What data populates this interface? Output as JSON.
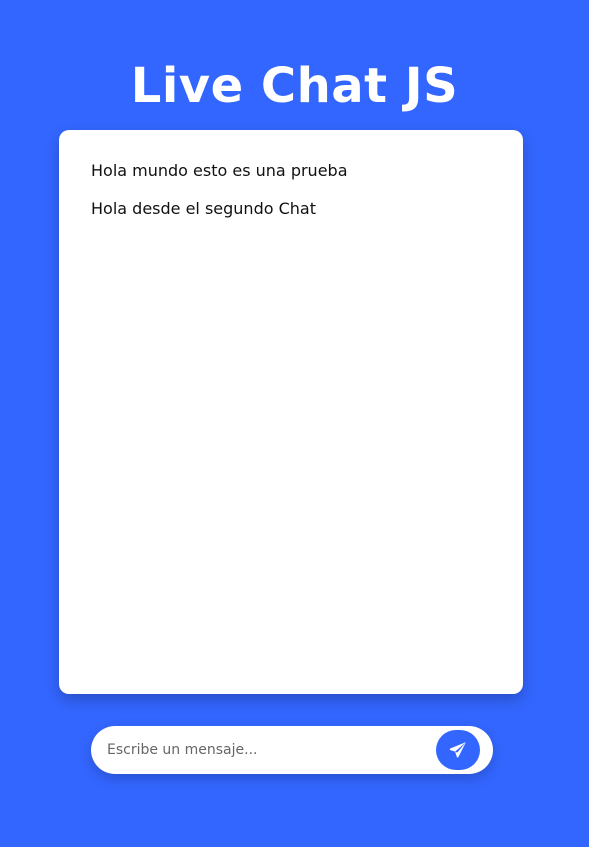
{
  "app": {
    "title": "Live Chat JS"
  },
  "chat": {
    "messages": [
      {
        "text": "Hola mundo esto es una prueba"
      },
      {
        "text": "Hola desde el segundo Chat"
      }
    ]
  },
  "composer": {
    "placeholder": "Escribe un mensaje...",
    "value": "",
    "send_icon": "paper-plane-icon"
  },
  "colors": {
    "background": "#3366ff",
    "panel": "#ffffff",
    "accent": "#3366ff",
    "text": "#111111"
  }
}
